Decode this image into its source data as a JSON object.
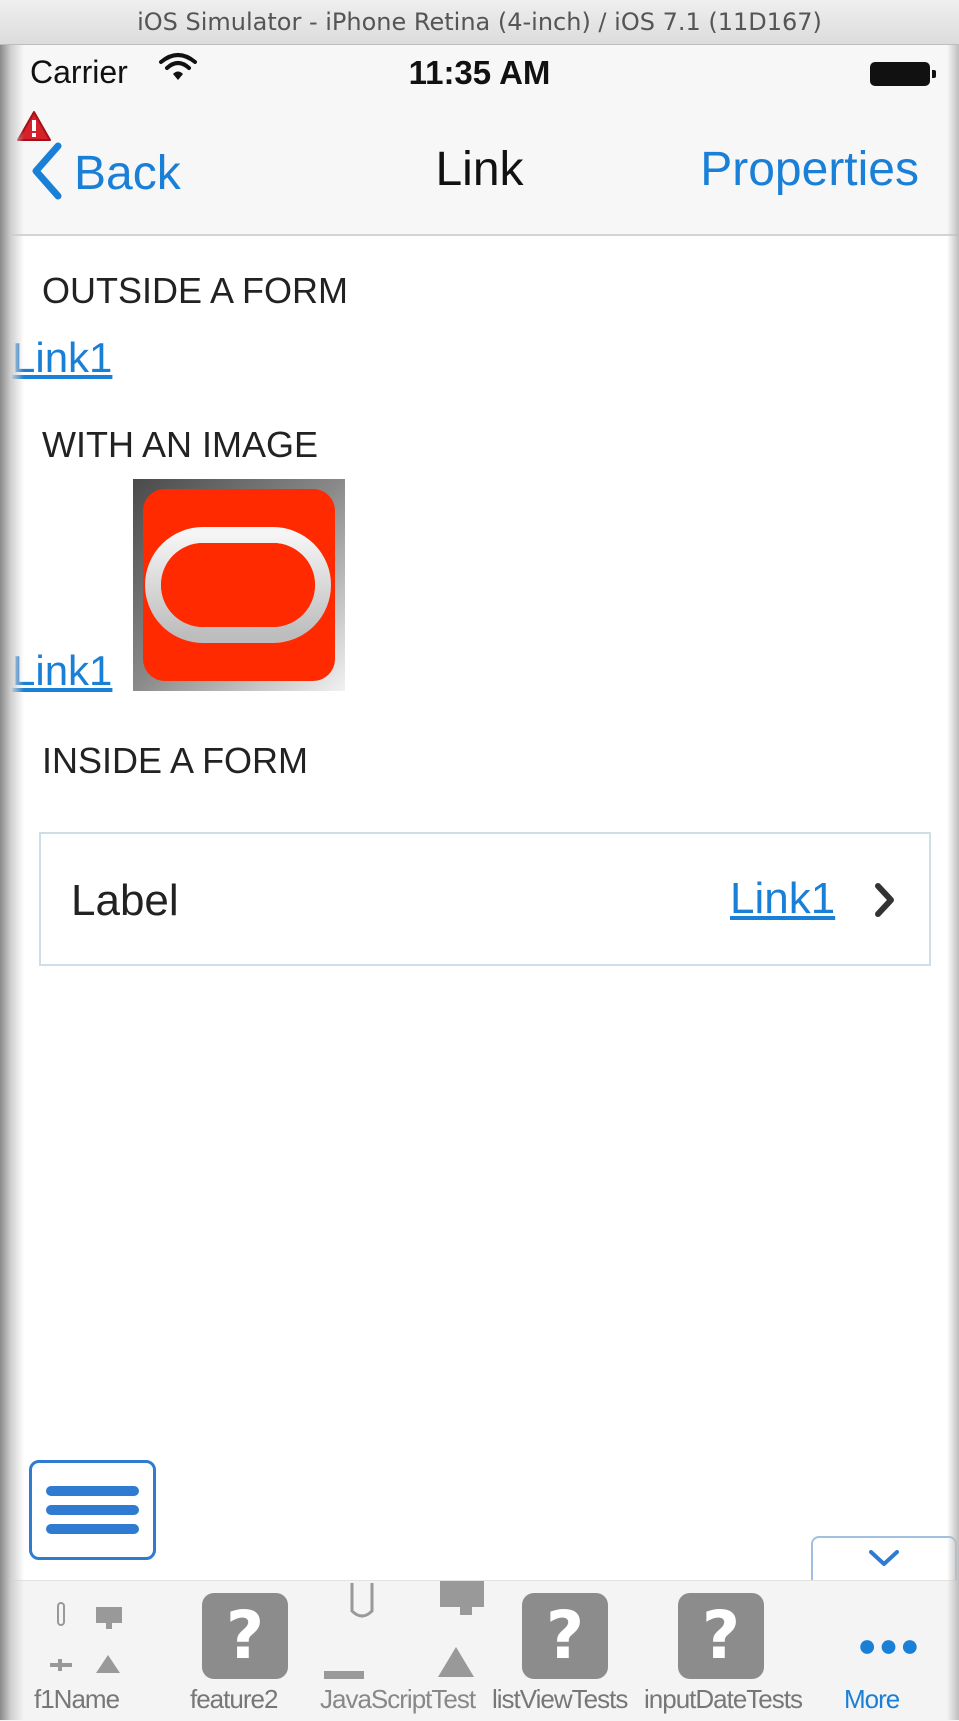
{
  "simulator": {
    "title": "iOS Simulator - iPhone Retina (4-inch) / iOS 7.1 (11D167)"
  },
  "status_bar": {
    "carrier": "Carrier",
    "time": "11:35 AM"
  },
  "nav": {
    "back_label": "Back",
    "title": "Link",
    "properties_label": "Properties"
  },
  "sections": {
    "outside": {
      "heading": "OUTSIDE A FORM",
      "link": "Link1"
    },
    "image": {
      "heading": "WITH AN IMAGE",
      "link": "Link1"
    },
    "form": {
      "heading": "INSIDE A FORM",
      "label": "Label",
      "link": "Link1"
    }
  },
  "tabs": [
    {
      "label": "f1Name",
      "icon": "feature-icons"
    },
    {
      "label": "feature2",
      "icon": "question-icon"
    },
    {
      "label": "JavaScriptTest",
      "icon": "feature-icons"
    },
    {
      "label": "listViewTests",
      "icon": "question-icon"
    },
    {
      "label": "inputDateTests",
      "icon": "question-icon"
    },
    {
      "label": "More",
      "icon": "more-icon",
      "active": true
    }
  ],
  "colors": {
    "accent": "#1a7fd6",
    "logo_red": "#ff2a00",
    "tab_inactive": "#777777"
  }
}
